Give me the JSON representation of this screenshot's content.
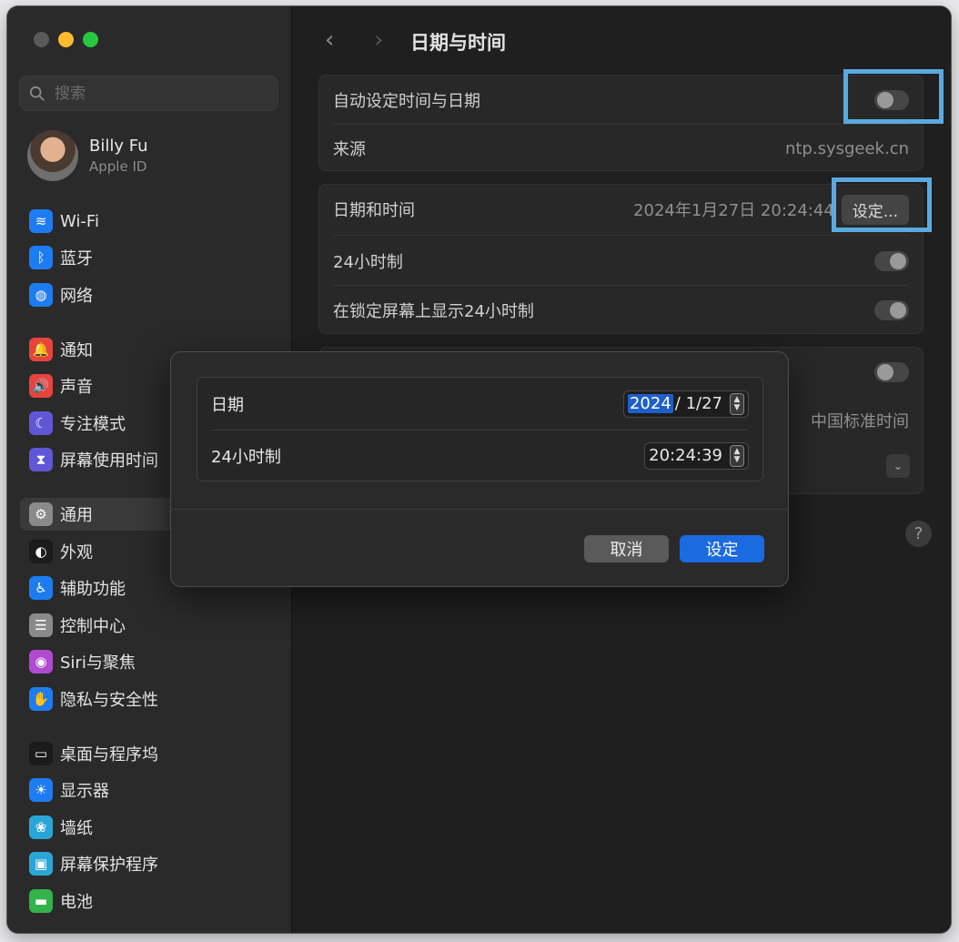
{
  "window": {
    "search_placeholder": "搜索",
    "profile": {
      "name": "Billy Fu",
      "subtitle": "Apple ID"
    }
  },
  "sidebar": {
    "items": [
      {
        "label": "Wi-Fi",
        "icon": "wifi-icon",
        "color": "#1e7cf2",
        "glyph": "≋"
      },
      {
        "label": "蓝牙",
        "icon": "bluetooth-icon",
        "color": "#1e7cf2",
        "glyph": "ᛒ"
      },
      {
        "label": "网络",
        "icon": "globe-icon",
        "color": "#1e7cf2",
        "glyph": "◍"
      },
      {
        "label": "通知",
        "icon": "bell-icon",
        "color": "#e8433d",
        "glyph": "🔔"
      },
      {
        "label": "声音",
        "icon": "speaker-icon",
        "color": "#e8433d",
        "glyph": "🔊"
      },
      {
        "label": "专注模式",
        "icon": "moon-icon",
        "color": "#5f57d6",
        "glyph": "☾"
      },
      {
        "label": "屏幕使用时间",
        "icon": "hourglass-icon",
        "color": "#5f57d6",
        "glyph": "⧗"
      },
      {
        "label": "通用",
        "icon": "gear-icon",
        "color": "#8a8a8a",
        "glyph": "⚙"
      },
      {
        "label": "外观",
        "icon": "appearance-icon",
        "color": "#1b1b1b",
        "glyph": "◐"
      },
      {
        "label": "辅助功能",
        "icon": "accessibility-icon",
        "color": "#1e7cf2",
        "glyph": "♿"
      },
      {
        "label": "控制中心",
        "icon": "switches-icon",
        "color": "#8a8a8a",
        "glyph": "☰"
      },
      {
        "label": "Siri与聚焦",
        "icon": "siri-icon",
        "color": "#b04ad1",
        "glyph": "◉"
      },
      {
        "label": "隐私与安全性",
        "icon": "hand-icon",
        "color": "#1e7cf2",
        "glyph": "✋"
      },
      {
        "label": "桌面与程序坞",
        "icon": "dock-icon",
        "color": "#1b1b1b",
        "glyph": "▭"
      },
      {
        "label": "显示器",
        "icon": "sun-icon",
        "color": "#1e7cf2",
        "glyph": "☀"
      },
      {
        "label": "墙纸",
        "icon": "flower-icon",
        "color": "#2aa6d6",
        "glyph": "❀"
      },
      {
        "label": "屏幕保护程序",
        "icon": "screensaver-icon",
        "color": "#2aa6d6",
        "glyph": "▣"
      },
      {
        "label": "电池",
        "icon": "battery-icon",
        "color": "#33b34a",
        "glyph": "▬"
      }
    ]
  },
  "main": {
    "title": "日期与时间",
    "group1": {
      "auto_label": "自动设定时间与日期",
      "source_label": "来源",
      "source_value": "ntp.sysgeek.cn"
    },
    "group2": {
      "datetime_label": "日期和时间",
      "datetime_value": "2024年1月27日 20:24:44",
      "set_button": "设定...",
      "h24_label": "24小时制",
      "lock_label": "在锁定屏幕上显示24小时制"
    },
    "group3": {
      "timezone_value": "中国标准时间"
    },
    "help": "?"
  },
  "modal": {
    "date_label": "日期",
    "date_year": "2024",
    "date_rest": "/  1/27",
    "time_label": "24小时制",
    "time_value": "20:24:39",
    "cancel": "取消",
    "ok": "设定"
  }
}
